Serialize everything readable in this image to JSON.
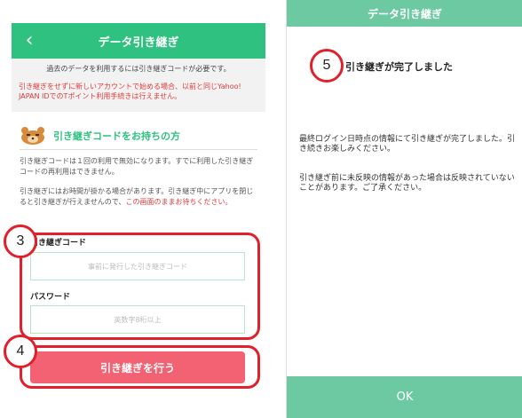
{
  "left": {
    "header": {
      "title": "データ引き継ぎ",
      "back_icon": "chevron-left-icon"
    },
    "info": {
      "required_text": "過去のデータを利用するには引き継ぎコードが必要です。",
      "warning_text": "引き継ぎをせずに新しいアカウントで始める場合、以前と同じYahoo! JAPAN IDでのTポイント利用手続きは行えません。"
    },
    "holder": {
      "icon": "bear-icon",
      "heading": "引き継ぎコードをお持ちの方"
    },
    "note1": "引き継ぎコードは１回の利用で無効になります。すでに利用した引き継ぎコードの再利用はできません。",
    "note2_black": "引き継ぎにはお時間が掛かる場合があります。引き継ぎ中にアプリを閉じると引き継ぎが行えませんので、",
    "note2_red": "この画面のままお待ちください。",
    "form": {
      "code_label": "引き継ぎコード",
      "code_placeholder": "事前に発行した引き継ぎコード",
      "password_label": "パスワード",
      "password_placeholder": "英数字8桁以上"
    },
    "submit_label": "引き継ぎを行う",
    "step3": "3",
    "step4": "4"
  },
  "right": {
    "header": {
      "title": "データ引き継ぎ"
    },
    "step5": "5",
    "complete_title": "引き継ぎが完了しました",
    "message1": "最終ログイン日時点の情報にて引き継ぎが完了しました。引き続きお楽しみください。",
    "message2": "引き継ぎ前に未反映の情報があった場合は反映されていないことがあります。ご了承ください。",
    "ok_label": "OK"
  },
  "colors": {
    "accent_green": "#2ec17f",
    "right_green": "#6cc9a1",
    "button_pink": "#f26272",
    "highlight_red": "#e0202a",
    "warning_red": "#e23a3a"
  }
}
